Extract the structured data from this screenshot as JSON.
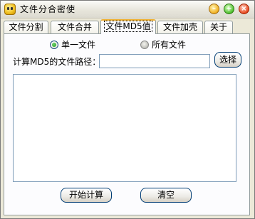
{
  "window": {
    "title": "文件分合密使"
  },
  "titlebar": {
    "minimize_icon": "minimize-icon",
    "maximize_icon": "maximize-icon",
    "close_icon": "close-icon"
  },
  "tabs": [
    {
      "label": "文件分割"
    },
    {
      "label": "文件合并"
    },
    {
      "label": "文件MD5值",
      "active": true
    },
    {
      "label": "文件加壳"
    },
    {
      "label": "关于"
    }
  ],
  "md5": {
    "mode_options": [
      {
        "label": "单一文件",
        "checked": true
      },
      {
        "label": "所有文件",
        "checked": false
      }
    ],
    "path_label": "计算MD5的文件路径：",
    "path_value": "",
    "choose_button": "选择",
    "result_text": "",
    "start_button": "开始计算",
    "clear_button": "清空"
  },
  "colors": {
    "window_bg": "#ece9d8",
    "panel_bg": "#fcfcfe",
    "active_tab_accent": "#f0b030",
    "radio_checked": "#21a121"
  }
}
